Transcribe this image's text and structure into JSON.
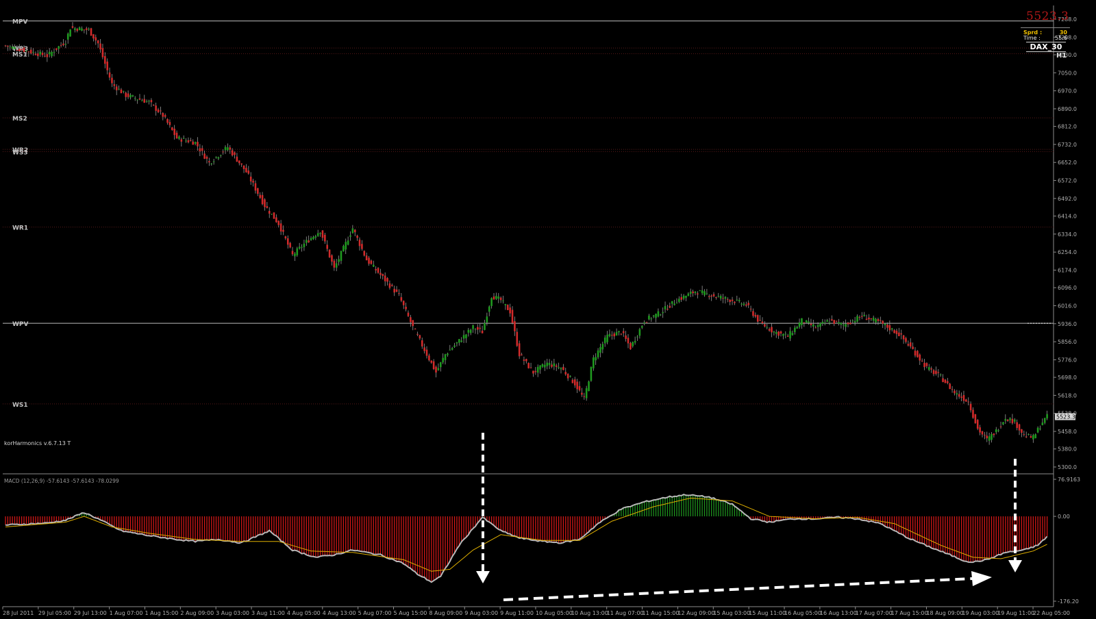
{
  "window": {
    "title": ""
  },
  "info_box": {
    "last_price": "5523.3",
    "spread_label": "Sprd :",
    "spread_value": "30",
    "time_label": "Time :",
    "time_value": "55:6",
    "symbol": "DAX_30",
    "timeframe": "H1"
  },
  "indicator_label": "korHarmonics v.6.7.13 T",
  "macd_label": "MACD (12,26,9) -57.6143 -57.6143 -78.0299",
  "colors": {
    "background": "#000000",
    "bull_candle": "#1f9a1f",
    "bear_candle": "#d22b2b",
    "macd_pos_hist": "#1f9a1f",
    "macd_neg_hist": "#e01818",
    "macd_line": "#b8b8b8",
    "signal_line": "#e0b000",
    "pivot_line": "#bdbdbd",
    "arrow": "#ffffff"
  },
  "chart_data": {
    "type": "candlestick",
    "symbol": "DAX_30",
    "timeframe": "H1",
    "price_axis": {
      "range": [
        5300.0,
        7288.0
      ],
      "tick_labels": [
        "7288.0",
        "7208.0",
        "7130.0",
        "7050.0",
        "6970.0",
        "6890.0",
        "6812.0",
        "6732.0",
        "6652.0",
        "6572.0",
        "6492.0",
        "6414.0",
        "6334.0",
        "6254.0",
        "6174.0",
        "6096.0",
        "6016.0",
        "5936.0",
        "5856.0",
        "5776.0",
        "5698.0",
        "5618.0",
        "5538.0",
        "5458.0",
        "5380.0",
        "5300.0"
      ],
      "current_price_label": "5523.3"
    },
    "time_axis": {
      "tick_labels": [
        "28 Jul 2011",
        "29 Jul 05:00",
        "29 Jul 13:00",
        "1 Aug 07:00",
        "1 Aug 15:00",
        "2 Aug 09:00",
        "3 Aug 03:00",
        "3 Aug 11:00",
        "4 Aug 05:00",
        "4 Aug 13:00",
        "5 Aug 07:00",
        "5 Aug 15:00",
        "8 Aug 09:00",
        "9 Aug 03:00",
        "9 Aug 11:00",
        "10 Aug 05:00",
        "10 Aug 13:00",
        "11 Aug 07:00",
        "11 Aug 15:00",
        "12 Aug 09:00",
        "15 Aug 03:00",
        "15 Aug 11:00",
        "16 Aug 05:00",
        "16 Aug 13:00",
        "17 Aug 07:00",
        "17 Aug 15:00",
        "18 Aug 09:00",
        "19 Aug 03:00",
        "19 Aug 11:00",
        "22 Aug 05:00"
      ]
    },
    "pivot_levels": [
      {
        "name": "MPV",
        "value": 7280,
        "style": "solid"
      },
      {
        "name": "WR3",
        "value": 7160,
        "style": "dotted"
      },
      {
        "name": "MS1",
        "value": 7135,
        "style": "dotted"
      },
      {
        "name": "MS2",
        "value": 6850,
        "style": "dotted"
      },
      {
        "name": "WR2",
        "value": 6710,
        "style": "dotted"
      },
      {
        "name": "WS3",
        "value": 6700,
        "style": "dotted"
      },
      {
        "name": "WR1",
        "value": 6365,
        "style": "dotted"
      },
      {
        "name": "WPV",
        "value": 5938,
        "style": "solid"
      },
      {
        "name": "WS1",
        "value": 5580,
        "style": "dotted"
      }
    ],
    "close_anchors": [
      [
        0,
        7170
      ],
      [
        18,
        7125
      ],
      [
        26,
        7190
      ],
      [
        28,
        7250
      ],
      [
        36,
        7240
      ],
      [
        40,
        7180
      ],
      [
        46,
        7000
      ],
      [
        52,
        6950
      ],
      [
        62,
        6920
      ],
      [
        68,
        6860
      ],
      [
        74,
        6760
      ],
      [
        82,
        6740
      ],
      [
        88,
        6650
      ],
      [
        96,
        6720
      ],
      [
        104,
        6610
      ],
      [
        112,
        6460
      ],
      [
        118,
        6380
      ],
      [
        124,
        6240
      ],
      [
        130,
        6300
      ],
      [
        136,
        6350
      ],
      [
        142,
        6180
      ],
      [
        150,
        6360
      ],
      [
        156,
        6220
      ],
      [
        164,
        6130
      ],
      [
        170,
        6060
      ],
      [
        176,
        5920
      ],
      [
        182,
        5800
      ],
      [
        186,
        5720
      ],
      [
        190,
        5800
      ],
      [
        196,
        5860
      ],
      [
        202,
        5920
      ],
      [
        206,
        5900
      ],
      [
        210,
        6060
      ],
      [
        214,
        6040
      ],
      [
        218,
        5990
      ],
      [
        222,
        5800
      ],
      [
        228,
        5720
      ],
      [
        234,
        5760
      ],
      [
        240,
        5740
      ],
      [
        246,
        5670
      ],
      [
        250,
        5600
      ],
      [
        254,
        5780
      ],
      [
        260,
        5880
      ],
      [
        266,
        5900
      ],
      [
        270,
        5830
      ],
      [
        276,
        5950
      ],
      [
        282,
        5980
      ],
      [
        290,
        6040
      ],
      [
        298,
        6080
      ],
      [
        306,
        6060
      ],
      [
        314,
        6040
      ],
      [
        320,
        6020
      ],
      [
        326,
        5940
      ],
      [
        332,
        5900
      ],
      [
        338,
        5880
      ],
      [
        344,
        5950
      ],
      [
        350,
        5920
      ],
      [
        356,
        5950
      ],
      [
        362,
        5930
      ],
      [
        370,
        5970
      ],
      [
        378,
        5940
      ],
      [
        386,
        5890
      ],
      [
        392,
        5820
      ],
      [
        398,
        5740
      ],
      [
        404,
        5700
      ],
      [
        410,
        5630
      ],
      [
        416,
        5590
      ],
      [
        420,
        5470
      ],
      [
        424,
        5420
      ],
      [
        428,
        5460
      ],
      [
        432,
        5520
      ],
      [
        436,
        5500
      ],
      [
        440,
        5440
      ],
      [
        444,
        5430
      ],
      [
        448,
        5500
      ],
      [
        450,
        5523
      ]
    ],
    "macd": {
      "params": "12,26,9",
      "values_text": "-57.6143 -57.6143 -78.0299",
      "axis_range": [
        -176.2,
        76.9163
      ],
      "tick_labels": [
        "76.9163",
        "0.00",
        "-176.20"
      ],
      "macd_anchors": [
        [
          0,
          -18
        ],
        [
          18,
          -14
        ],
        [
          26,
          -8
        ],
        [
          34,
          8
        ],
        [
          40,
          -5
        ],
        [
          50,
          -30
        ],
        [
          62,
          -40
        ],
        [
          74,
          -48
        ],
        [
          82,
          -52
        ],
        [
          92,
          -48
        ],
        [
          102,
          -55
        ],
        [
          114,
          -30
        ],
        [
          124,
          -70
        ],
        [
          134,
          -85
        ],
        [
          142,
          -80
        ],
        [
          150,
          -70
        ],
        [
          162,
          -80
        ],
        [
          172,
          -98
        ],
        [
          178,
          -120
        ],
        [
          184,
          -136
        ],
        [
          188,
          -125
        ],
        [
          196,
          -60
        ],
        [
          206,
          -2
        ],
        [
          214,
          -30
        ],
        [
          222,
          -45
        ],
        [
          232,
          -52
        ],
        [
          240,
          -55
        ],
        [
          248,
          -48
        ],
        [
          256,
          -15
        ],
        [
          266,
          15
        ],
        [
          276,
          30
        ],
        [
          286,
          40
        ],
        [
          294,
          45
        ],
        [
          304,
          40
        ],
        [
          314,
          25
        ],
        [
          322,
          -5
        ],
        [
          330,
          -12
        ],
        [
          340,
          -5
        ],
        [
          350,
          -5
        ],
        [
          360,
          -2
        ],
        [
          368,
          -5
        ],
        [
          378,
          -15
        ],
        [
          390,
          -45
        ],
        [
          400,
          -65
        ],
        [
          408,
          -80
        ],
        [
          414,
          -92
        ],
        [
          418,
          -95
        ],
        [
          424,
          -90
        ],
        [
          432,
          -75
        ],
        [
          440,
          -70
        ],
        [
          446,
          -60
        ],
        [
          450,
          -42
        ]
      ],
      "signal_anchors": [
        [
          0,
          -22
        ],
        [
          26,
          -12
        ],
        [
          34,
          0
        ],
        [
          46,
          -22
        ],
        [
          62,
          -35
        ],
        [
          82,
          -48
        ],
        [
          102,
          -52
        ],
        [
          118,
          -52
        ],
        [
          132,
          -72
        ],
        [
          150,
          -75
        ],
        [
          172,
          -90
        ],
        [
          184,
          -114
        ],
        [
          192,
          -110
        ],
        [
          202,
          -70
        ],
        [
          214,
          -38
        ],
        [
          232,
          -50
        ],
        [
          248,
          -50
        ],
        [
          262,
          -10
        ],
        [
          280,
          20
        ],
        [
          296,
          38
        ],
        [
          314,
          32
        ],
        [
          330,
          0
        ],
        [
          350,
          -5
        ],
        [
          368,
          -2
        ],
        [
          384,
          -15
        ],
        [
          404,
          -60
        ],
        [
          418,
          -85
        ],
        [
          430,
          -88
        ],
        [
          444,
          -72
        ],
        [
          450,
          -58
        ]
      ]
    }
  }
}
